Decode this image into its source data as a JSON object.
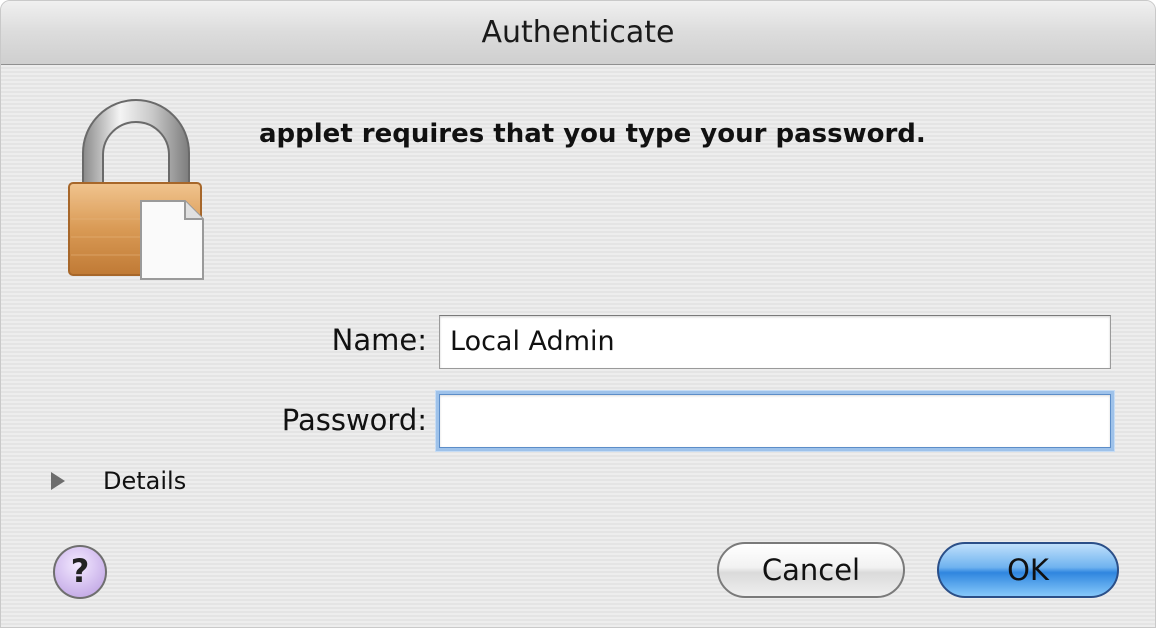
{
  "window": {
    "title": "Authenticate"
  },
  "dialog": {
    "icon": "lock-with-document-icon",
    "message": "applet requires that you type your password.",
    "name_label": "Name:",
    "name_value": "Local Admin",
    "password_label": "Password:",
    "password_value": "",
    "details_label": "Details",
    "help_label": "?",
    "cancel_label": "Cancel",
    "ok_label": "OK"
  },
  "colors": {
    "default_button": "#4f9fe9",
    "focus_ring": "#9ec2ea",
    "help_button": "#d9c6f2"
  }
}
